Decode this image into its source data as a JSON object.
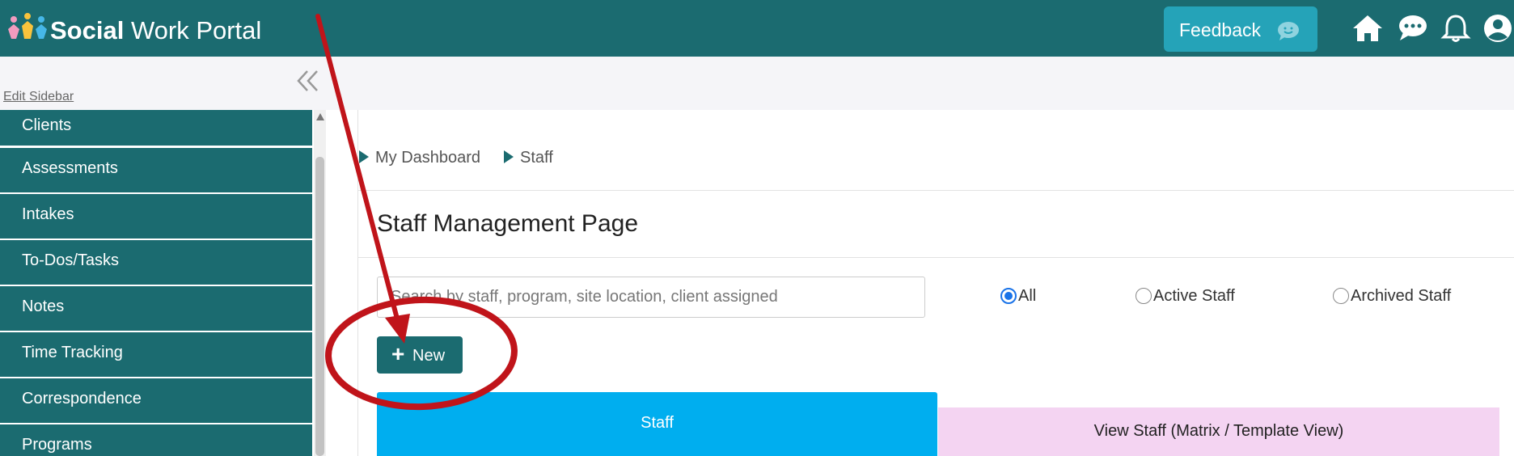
{
  "header": {
    "brand_bold": "Social",
    "brand_light": " Work Portal",
    "feedback_label": "Feedback",
    "icons": [
      "home-icon",
      "chat-icon",
      "bell-icon",
      "user-icon"
    ]
  },
  "sidebar": {
    "edit_label": "Edit Sidebar",
    "items": [
      {
        "label": "Clients"
      },
      {
        "label": "Assessments"
      },
      {
        "label": "Intakes"
      },
      {
        "label": "To-Dos/Tasks"
      },
      {
        "label": "Notes"
      },
      {
        "label": "Time Tracking"
      },
      {
        "label": "Correspondence"
      },
      {
        "label": "Programs"
      }
    ]
  },
  "breadcrumb": {
    "items": [
      "My Dashboard",
      "Staff"
    ]
  },
  "main": {
    "title": "Staff Management Page",
    "search_placeholder": "Search by staff, program, site location, client assigned",
    "filters": [
      {
        "label": "All",
        "checked": true
      },
      {
        "label": "Active Staff",
        "checked": false
      },
      {
        "label": "Archived Staff",
        "checked": false
      }
    ],
    "new_button": "New",
    "tabs": [
      {
        "label": "Staff",
        "active": true
      },
      {
        "label": "View Staff (Matrix / Template View)",
        "active": false
      }
    ]
  },
  "colors": {
    "primary": "#1b6b70",
    "feedback": "#25a3b8",
    "tab_active": "#00aeef",
    "tab_inactive": "#f4d4f2",
    "annotation": "#c0141a"
  }
}
